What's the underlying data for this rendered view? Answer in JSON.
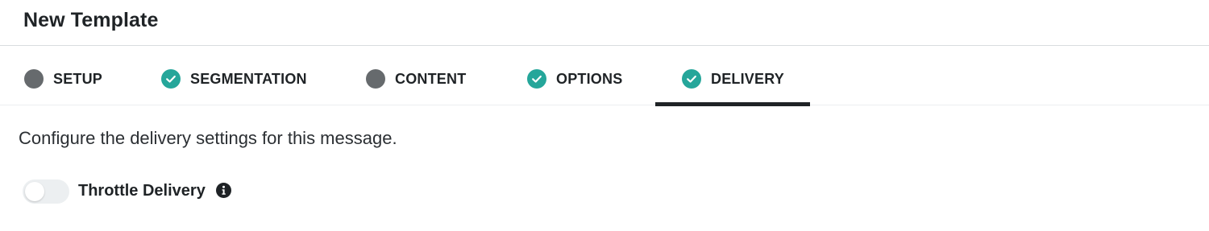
{
  "header": {
    "title": "New Template"
  },
  "tabs": [
    {
      "label": "SETUP",
      "status": "pending",
      "status_icon": "pending-dot-icon",
      "active": false
    },
    {
      "label": "SEGMENTATION",
      "status": "done",
      "status_icon": "checkmark-circle-icon",
      "active": false
    },
    {
      "label": "CONTENT",
      "status": "pending",
      "status_icon": "pending-dot-icon",
      "active": false
    },
    {
      "label": "OPTIONS",
      "status": "done",
      "status_icon": "checkmark-circle-icon",
      "active": false
    },
    {
      "label": "DELIVERY",
      "status": "done",
      "status_icon": "checkmark-circle-icon",
      "active": true
    }
  ],
  "main": {
    "description": "Configure the delivery settings for this message.",
    "throttle": {
      "label": "Throttle Delivery",
      "enabled": false,
      "info_icon": "info-icon"
    }
  },
  "colors": {
    "done": "#25a69a",
    "pending": "#666a6d",
    "active_indicator": "#1f2326",
    "toggle_off": "#eceff1"
  }
}
